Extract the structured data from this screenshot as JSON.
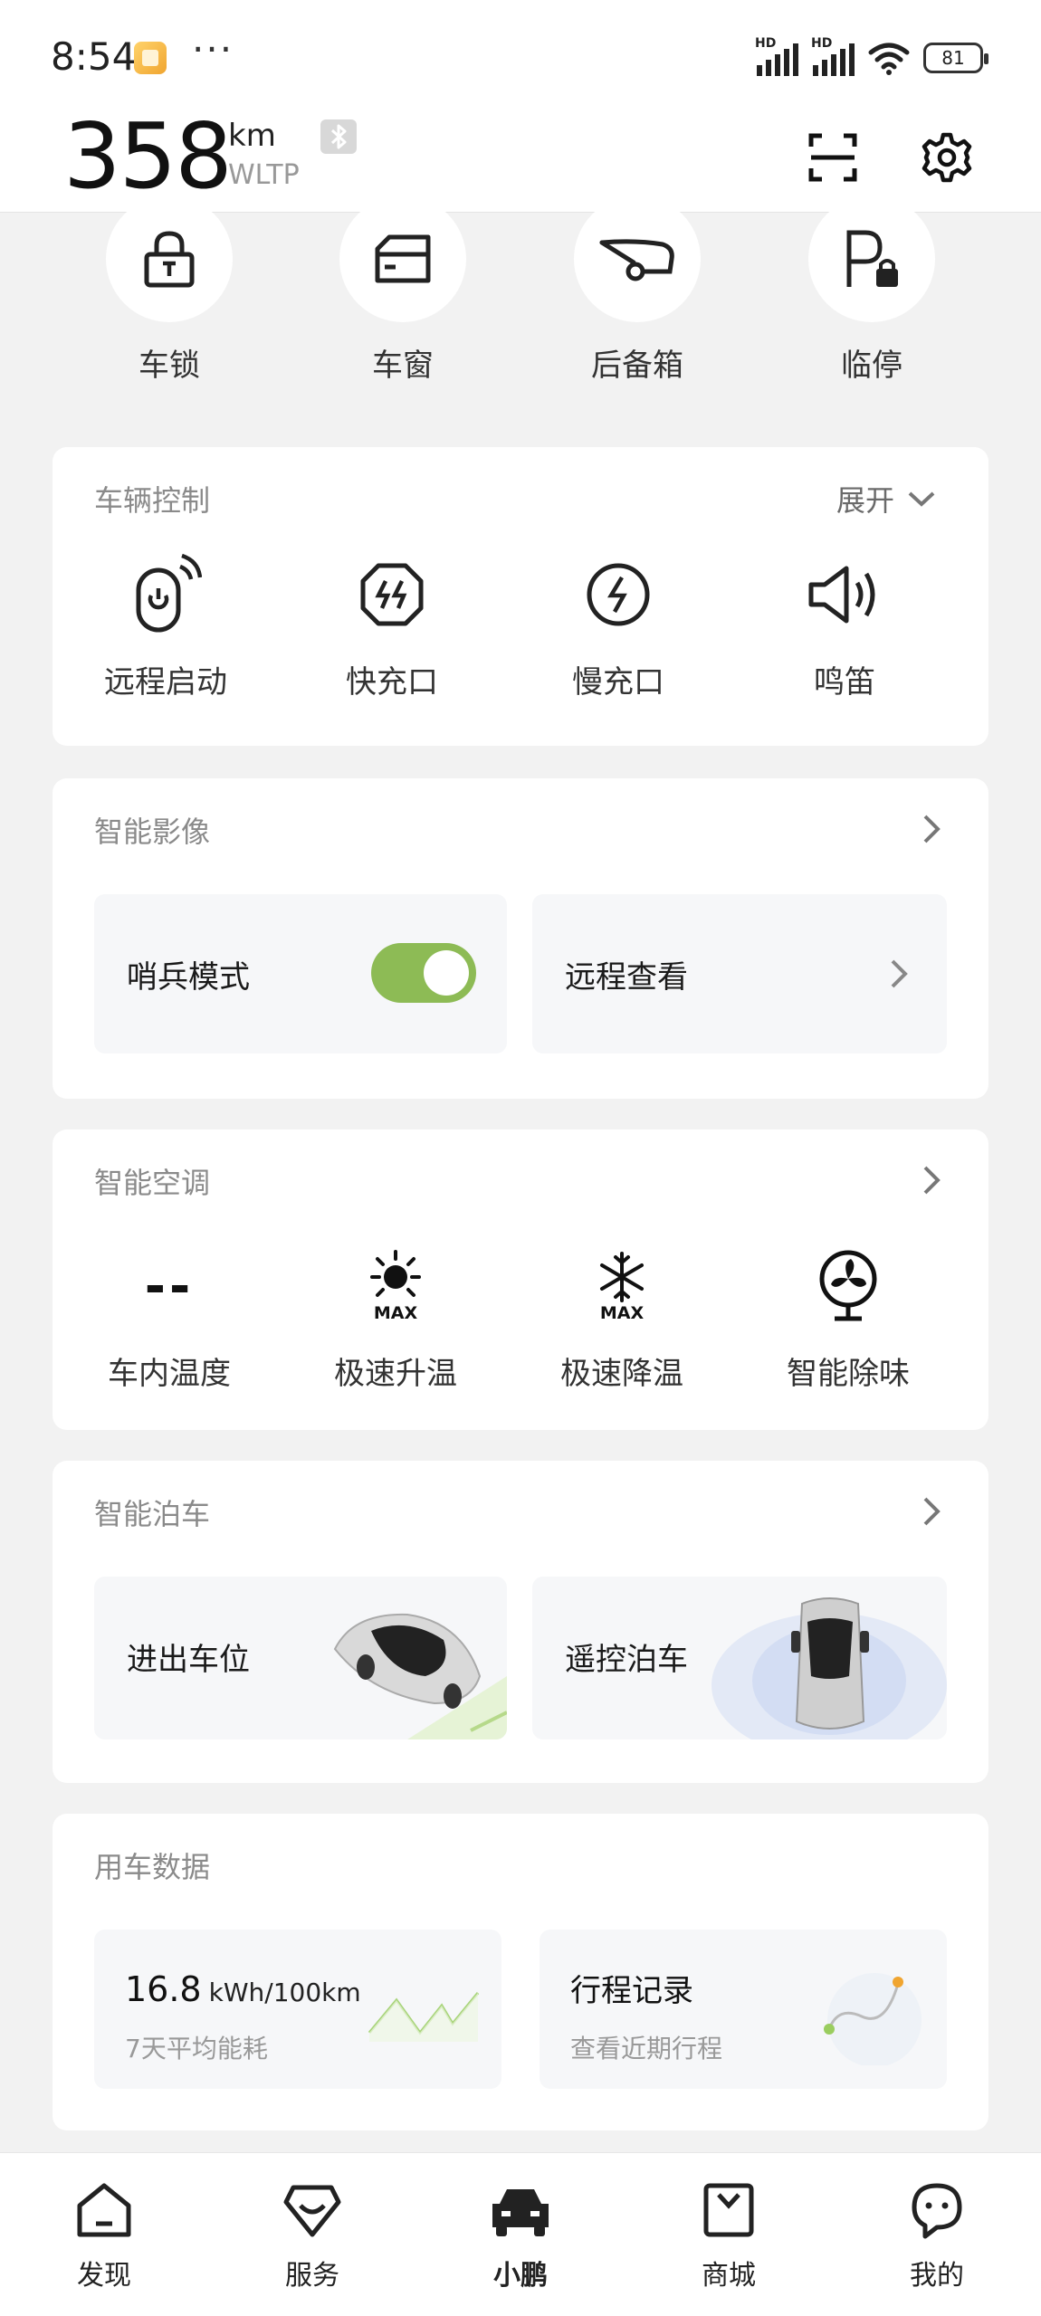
{
  "status_bar": {
    "time": "8:54",
    "dots": "···",
    "signal_label": "HD",
    "battery": "81"
  },
  "header": {
    "range_value": "358",
    "range_unit": "km",
    "range_standard": "WLTP"
  },
  "quick_actions": [
    {
      "label": "车锁",
      "icon": "lock-icon"
    },
    {
      "label": "车窗",
      "icon": "window-icon"
    },
    {
      "label": "后备箱",
      "icon": "trunk-icon"
    },
    {
      "label": "临停",
      "icon": "parking-lock-icon"
    }
  ],
  "vehicle_control": {
    "title": "车辆控制",
    "expand_label": "展开",
    "items": [
      {
        "label": "远程启动",
        "icon": "remote-start-icon"
      },
      {
        "label": "快充口",
        "icon": "fast-charge-icon"
      },
      {
        "label": "慢充口",
        "icon": "slow-charge-icon"
      },
      {
        "label": "鸣笛",
        "icon": "horn-icon"
      }
    ]
  },
  "smart_camera": {
    "title": "智能影像",
    "sentry_label": "哨兵模式",
    "sentry_enabled": true,
    "remote_view_label": "远程查看"
  },
  "climate": {
    "title": "智能空调",
    "items": [
      {
        "label": "车内温度",
        "value": "--"
      },
      {
        "label": "极速升温",
        "icon_text": "MAX"
      },
      {
        "label": "极速降温",
        "icon_text": "MAX"
      },
      {
        "label": "智能除味"
      }
    ]
  },
  "parking": {
    "title": "智能泊车",
    "tiles": [
      {
        "label": "进出车位"
      },
      {
        "label": "遥控泊车"
      }
    ]
  },
  "usage": {
    "title": "用车数据",
    "energy_value": "16.8",
    "energy_unit": "kWh/100km",
    "energy_caption": "7天平均能耗",
    "trip_title": "行程记录",
    "trip_caption": "查看近期行程"
  },
  "bottom_nav": [
    {
      "label": "发现",
      "icon": "home-icon"
    },
    {
      "label": "服务",
      "icon": "service-icon"
    },
    {
      "label": "小鹏",
      "icon": "car-icon",
      "active": true
    },
    {
      "label": "商城",
      "icon": "shop-bag-icon"
    },
    {
      "label": "我的",
      "icon": "profile-icon"
    }
  ],
  "colors": {
    "accent_green": "#8dbb55",
    "background": "#f2f2f2",
    "card": "#ffffff"
  }
}
